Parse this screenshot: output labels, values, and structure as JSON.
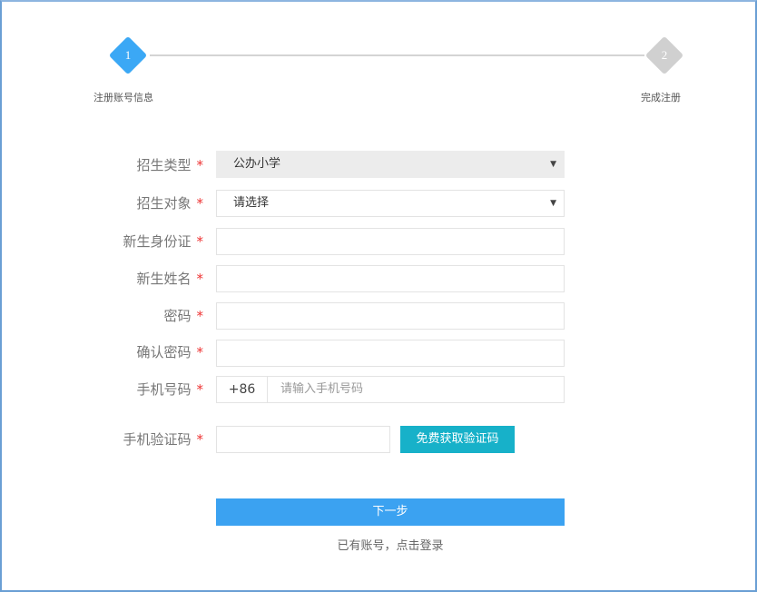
{
  "steps": [
    {
      "number": "1",
      "label": "注册账号信息",
      "color": "#3ba8f5"
    },
    {
      "number": "2",
      "label": "完成注册",
      "color": "#d0d0d0"
    }
  ],
  "form": {
    "required_mark": "*",
    "school_type": {
      "label": "招生类型",
      "value": "公办小学"
    },
    "target": {
      "label": "招生对象",
      "value": "请选择"
    },
    "id_card": {
      "label": "新生身份证",
      "value": ""
    },
    "name": {
      "label": "新生姓名",
      "value": ""
    },
    "password": {
      "label": "密码",
      "value": ""
    },
    "confirm_password": {
      "label": "确认密码",
      "value": ""
    },
    "phone": {
      "label": "手机号码",
      "prefix": "+86",
      "placeholder": "请输入手机号码"
    },
    "sms_code": {
      "label": "手机验证码",
      "value": "",
      "button": "免费获取验证码"
    }
  },
  "next_button": "下一步",
  "login_link": "已有账号，点击登录"
}
